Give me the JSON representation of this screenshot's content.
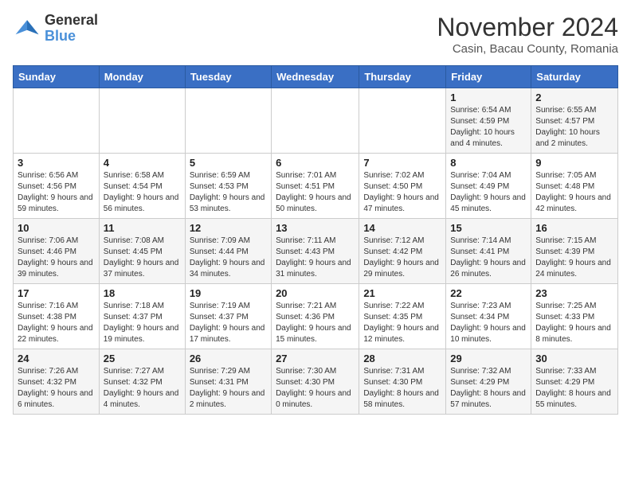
{
  "logo": {
    "line1": "General",
    "line2": "Blue"
  },
  "title": "November 2024",
  "subtitle": "Casin, Bacau County, Romania",
  "days_of_week": [
    "Sunday",
    "Monday",
    "Tuesday",
    "Wednesday",
    "Thursday",
    "Friday",
    "Saturday"
  ],
  "weeks": [
    [
      {
        "day": "",
        "info": ""
      },
      {
        "day": "",
        "info": ""
      },
      {
        "day": "",
        "info": ""
      },
      {
        "day": "",
        "info": ""
      },
      {
        "day": "",
        "info": ""
      },
      {
        "day": "1",
        "info": "Sunrise: 6:54 AM\nSunset: 4:59 PM\nDaylight: 10 hours and 4 minutes."
      },
      {
        "day": "2",
        "info": "Sunrise: 6:55 AM\nSunset: 4:57 PM\nDaylight: 10 hours and 2 minutes."
      }
    ],
    [
      {
        "day": "3",
        "info": "Sunrise: 6:56 AM\nSunset: 4:56 PM\nDaylight: 9 hours and 59 minutes."
      },
      {
        "day": "4",
        "info": "Sunrise: 6:58 AM\nSunset: 4:54 PM\nDaylight: 9 hours and 56 minutes."
      },
      {
        "day": "5",
        "info": "Sunrise: 6:59 AM\nSunset: 4:53 PM\nDaylight: 9 hours and 53 minutes."
      },
      {
        "day": "6",
        "info": "Sunrise: 7:01 AM\nSunset: 4:51 PM\nDaylight: 9 hours and 50 minutes."
      },
      {
        "day": "7",
        "info": "Sunrise: 7:02 AM\nSunset: 4:50 PM\nDaylight: 9 hours and 47 minutes."
      },
      {
        "day": "8",
        "info": "Sunrise: 7:04 AM\nSunset: 4:49 PM\nDaylight: 9 hours and 45 minutes."
      },
      {
        "day": "9",
        "info": "Sunrise: 7:05 AM\nSunset: 4:48 PM\nDaylight: 9 hours and 42 minutes."
      }
    ],
    [
      {
        "day": "10",
        "info": "Sunrise: 7:06 AM\nSunset: 4:46 PM\nDaylight: 9 hours and 39 minutes."
      },
      {
        "day": "11",
        "info": "Sunrise: 7:08 AM\nSunset: 4:45 PM\nDaylight: 9 hours and 37 minutes."
      },
      {
        "day": "12",
        "info": "Sunrise: 7:09 AM\nSunset: 4:44 PM\nDaylight: 9 hours and 34 minutes."
      },
      {
        "day": "13",
        "info": "Sunrise: 7:11 AM\nSunset: 4:43 PM\nDaylight: 9 hours and 31 minutes."
      },
      {
        "day": "14",
        "info": "Sunrise: 7:12 AM\nSunset: 4:42 PM\nDaylight: 9 hours and 29 minutes."
      },
      {
        "day": "15",
        "info": "Sunrise: 7:14 AM\nSunset: 4:41 PM\nDaylight: 9 hours and 26 minutes."
      },
      {
        "day": "16",
        "info": "Sunrise: 7:15 AM\nSunset: 4:39 PM\nDaylight: 9 hours and 24 minutes."
      }
    ],
    [
      {
        "day": "17",
        "info": "Sunrise: 7:16 AM\nSunset: 4:38 PM\nDaylight: 9 hours and 22 minutes."
      },
      {
        "day": "18",
        "info": "Sunrise: 7:18 AM\nSunset: 4:37 PM\nDaylight: 9 hours and 19 minutes."
      },
      {
        "day": "19",
        "info": "Sunrise: 7:19 AM\nSunset: 4:37 PM\nDaylight: 9 hours and 17 minutes."
      },
      {
        "day": "20",
        "info": "Sunrise: 7:21 AM\nSunset: 4:36 PM\nDaylight: 9 hours and 15 minutes."
      },
      {
        "day": "21",
        "info": "Sunrise: 7:22 AM\nSunset: 4:35 PM\nDaylight: 9 hours and 12 minutes."
      },
      {
        "day": "22",
        "info": "Sunrise: 7:23 AM\nSunset: 4:34 PM\nDaylight: 9 hours and 10 minutes."
      },
      {
        "day": "23",
        "info": "Sunrise: 7:25 AM\nSunset: 4:33 PM\nDaylight: 9 hours and 8 minutes."
      }
    ],
    [
      {
        "day": "24",
        "info": "Sunrise: 7:26 AM\nSunset: 4:32 PM\nDaylight: 9 hours and 6 minutes."
      },
      {
        "day": "25",
        "info": "Sunrise: 7:27 AM\nSunset: 4:32 PM\nDaylight: 9 hours and 4 minutes."
      },
      {
        "day": "26",
        "info": "Sunrise: 7:29 AM\nSunset: 4:31 PM\nDaylight: 9 hours and 2 minutes."
      },
      {
        "day": "27",
        "info": "Sunrise: 7:30 AM\nSunset: 4:30 PM\nDaylight: 9 hours and 0 minutes."
      },
      {
        "day": "28",
        "info": "Sunrise: 7:31 AM\nSunset: 4:30 PM\nDaylight: 8 hours and 58 minutes."
      },
      {
        "day": "29",
        "info": "Sunrise: 7:32 AM\nSunset: 4:29 PM\nDaylight: 8 hours and 57 minutes."
      },
      {
        "day": "30",
        "info": "Sunrise: 7:33 AM\nSunset: 4:29 PM\nDaylight: 8 hours and 55 minutes."
      }
    ]
  ]
}
